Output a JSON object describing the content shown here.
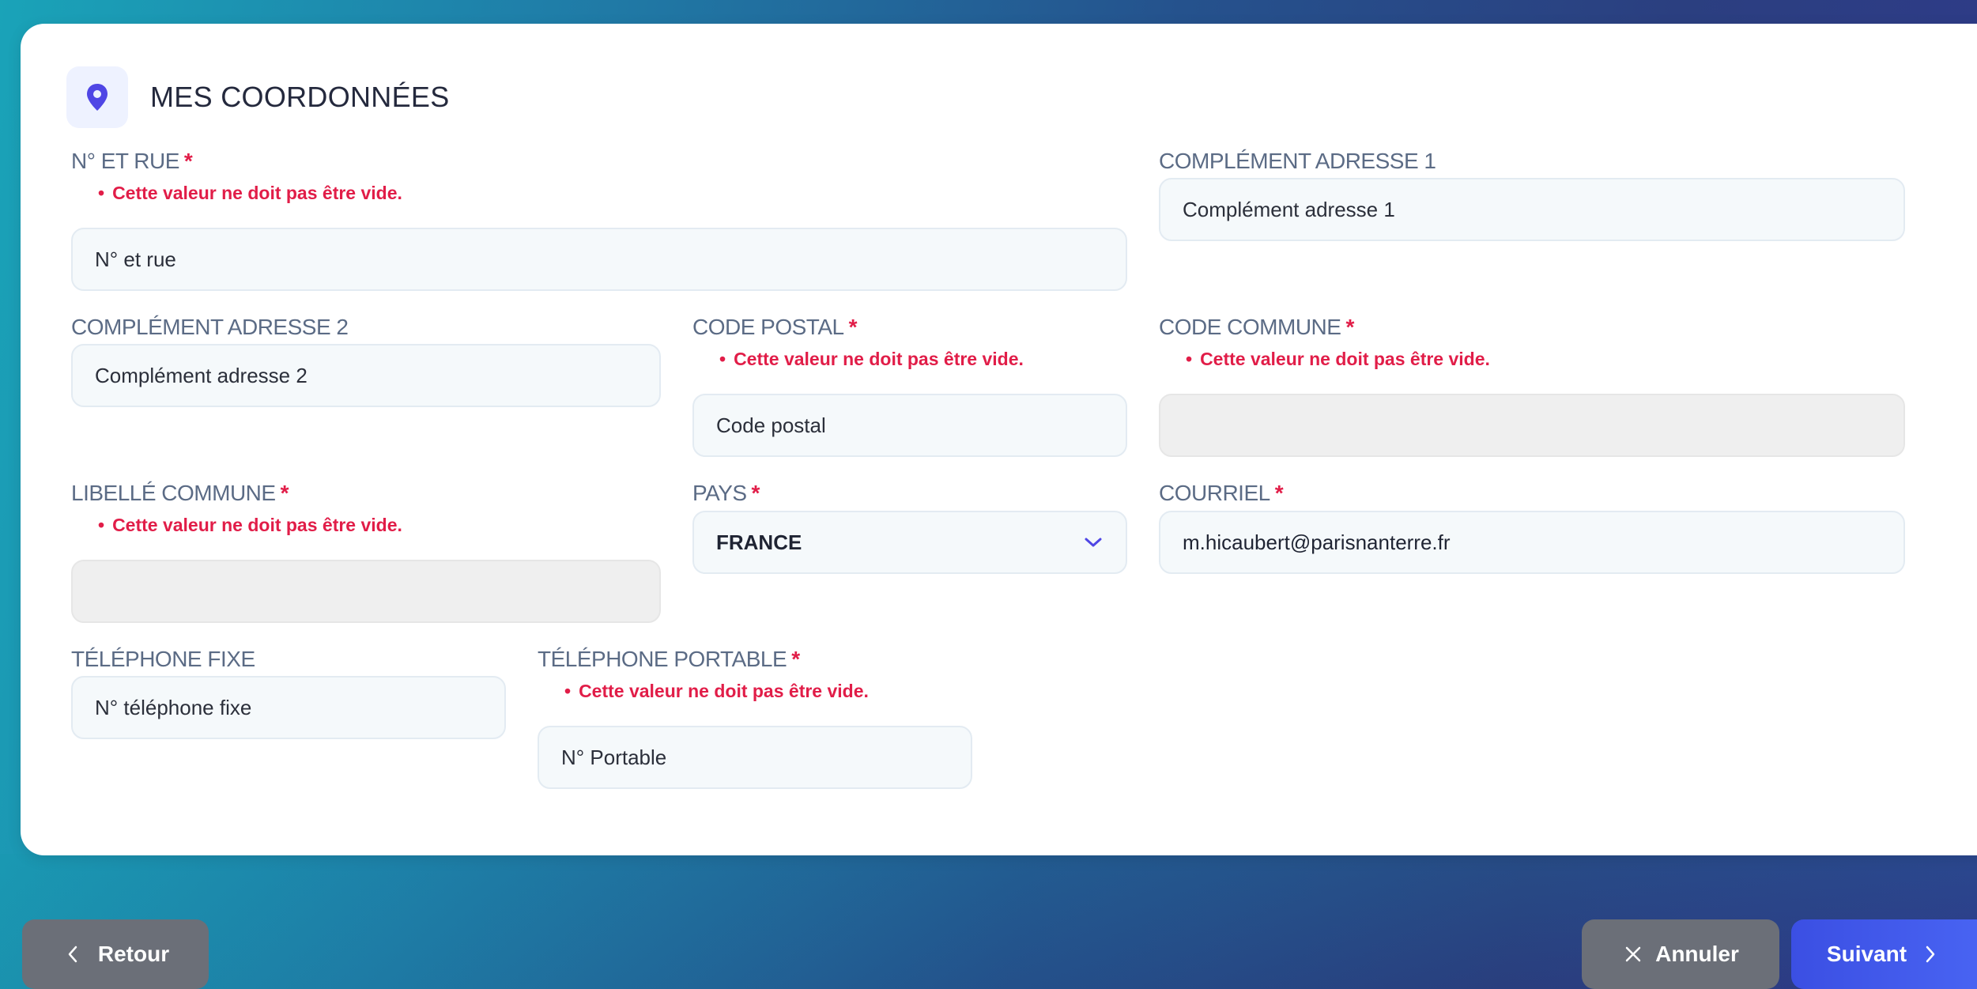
{
  "section": {
    "title": "MES COORDONNÉES",
    "icon": "map-pin-icon"
  },
  "validation_message": "Cette valeur ne doit pas être vide.",
  "required_marker": "*",
  "fields": {
    "street": {
      "label": "N° ET RUE",
      "required": true,
      "error": "Cette valeur ne doit pas être vide.",
      "placeholder": "N° et rue",
      "value": ""
    },
    "address_complement_1": {
      "label": "COMPLÉMENT ADRESSE 1",
      "required": false,
      "placeholder": "Complément adresse 1",
      "value": ""
    },
    "address_complement_2": {
      "label": "COMPLÉMENT ADRESSE 2",
      "required": false,
      "placeholder": "Complément adresse 2",
      "value": ""
    },
    "postal_code": {
      "label": "CODE POSTAL",
      "required": true,
      "error": "Cette valeur ne doit pas être vide.",
      "placeholder": "Code postal",
      "value": ""
    },
    "commune_code": {
      "label": "CODE COMMUNE",
      "required": true,
      "error": "Cette valeur ne doit pas être vide.",
      "value": ""
    },
    "commune_label": {
      "label": "LIBELLÉ COMMUNE",
      "required": true,
      "error": "Cette valeur ne doit pas être vide.",
      "value": ""
    },
    "country": {
      "label": "PAYS",
      "required": true,
      "value": "FRANCE"
    },
    "email": {
      "label": "COURRIEL",
      "required": true,
      "value": "m.hicaubert@parisnanterre.fr"
    },
    "landline": {
      "label": "TÉLÉPHONE FIXE",
      "required": false,
      "placeholder": "N° téléphone fixe",
      "value": ""
    },
    "mobile": {
      "label": "TÉLÉPHONE PORTABLE",
      "required": true,
      "error": "Cette valeur ne doit pas être vide.",
      "placeholder": "N° Portable",
      "value": ""
    }
  },
  "buttons": {
    "back": "Retour",
    "cancel": "Annuler",
    "next": "Suivant"
  },
  "colors": {
    "accent": "#4f46e5",
    "error": "#e11d48",
    "label": "#5b6b85",
    "button_gray": "#6b6f78",
    "button_blue": "#4359ec"
  }
}
